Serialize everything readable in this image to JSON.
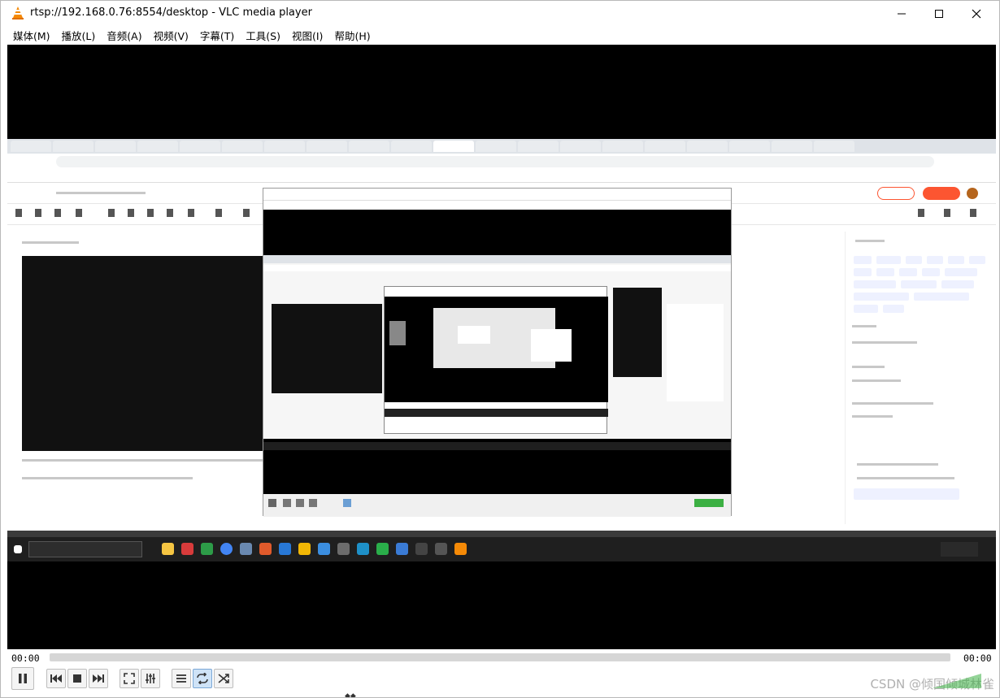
{
  "window": {
    "title": "rtsp://192.168.0.76:8554/desktop - VLC media player"
  },
  "menu": {
    "items": [
      "媒体(M)",
      "播放(L)",
      "音频(A)",
      "视频(V)",
      "字幕(T)",
      "工具(S)",
      "视图(I)",
      "帮助(H)"
    ]
  },
  "controls": {
    "time_elapsed": "00:00",
    "time_total": "00:00",
    "progress": 0
  },
  "watermark": "CSDN @倾国倾城林雀"
}
